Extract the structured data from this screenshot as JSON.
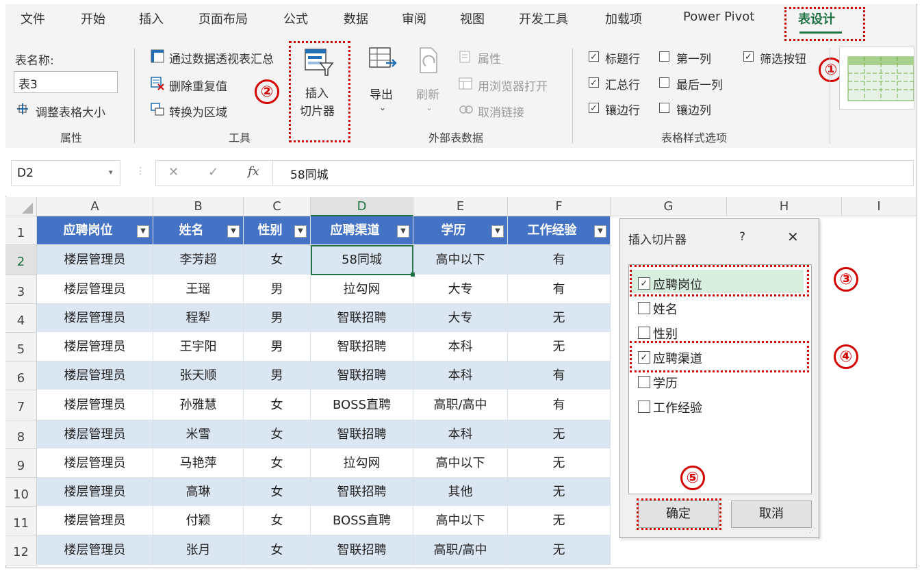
{
  "tabs": [
    "文件",
    "开始",
    "插入",
    "页面布局",
    "公式",
    "数据",
    "审阅",
    "视图",
    "开发工具",
    "加载项",
    "Power Pivot",
    "表设计"
  ],
  "props": {
    "name_label": "表名称:",
    "table_name": "表3",
    "resize": "调整表格大小",
    "group": "属性"
  },
  "tools": {
    "pivot": "通过数据透视表汇总",
    "dedupe": "删除重复值",
    "convert": "转换为区域",
    "group": "工具"
  },
  "slicer": {
    "line1": "插入",
    "line2": "切片器"
  },
  "external": {
    "export": "导出",
    "refresh": "刷新",
    "properties": "属性",
    "open_browser": "用浏览器打开",
    "unlink": "取消链接",
    "group": "外部表数据"
  },
  "style_opts": {
    "header_row": "标题行",
    "first_col": "第一列",
    "filter_btn": "筛选按钮",
    "total_row": "汇总行",
    "last_col": "最后一列",
    "banded_rows": "镶边行",
    "banded_cols": "镶边列",
    "group": "表格样式选项"
  },
  "formula": {
    "ref": "D2",
    "fx": "fx",
    "value": "58同城"
  },
  "columns": [
    "A",
    "B",
    "C",
    "D",
    "E",
    "F",
    "G",
    "H",
    "I"
  ],
  "rows": [
    "1",
    "2",
    "3",
    "4",
    "5",
    "6",
    "7",
    "8",
    "9",
    "10",
    "11",
    "12"
  ],
  "table": {
    "headers": [
      "应聘岗位",
      "姓名",
      "性别",
      "应聘渠道",
      "学历",
      "工作经验"
    ],
    "data": [
      [
        "楼层管理员",
        "李芳超",
        "女",
        "58同城",
        "高中以下",
        "有"
      ],
      [
        "楼层管理员",
        "王瑶",
        "男",
        "拉勾网",
        "大专",
        "有"
      ],
      [
        "楼层管理员",
        "程犁",
        "男",
        "智联招聘",
        "大专",
        "无"
      ],
      [
        "楼层管理员",
        "王宇阳",
        "男",
        "智联招聘",
        "本科",
        "无"
      ],
      [
        "楼层管理员",
        "张天顺",
        "男",
        "智联招聘",
        "本科",
        "有"
      ],
      [
        "楼层管理员",
        "孙雅慧",
        "女",
        "BOSS直聘",
        "高职/高中",
        "有"
      ],
      [
        "楼层管理员",
        "米雪",
        "女",
        "智联招聘",
        "本科",
        "无"
      ],
      [
        "楼层管理员",
        "马艳萍",
        "女",
        "拉勾网",
        "高中以下",
        "无"
      ],
      [
        "楼层管理员",
        "高琳",
        "女",
        "智联招聘",
        "其他",
        "无"
      ],
      [
        "楼层管理员",
        "付颖",
        "女",
        "BOSS直聘",
        "高中以下",
        "无"
      ],
      [
        "楼层管理员",
        "张月",
        "女",
        "智联招聘",
        "高职/高中",
        "无"
      ]
    ]
  },
  "dialog": {
    "title": "插入切片器",
    "help": "?",
    "close": "✕",
    "items": [
      {
        "label": "应聘岗位",
        "checked": true
      },
      {
        "label": "姓名",
        "checked": false
      },
      {
        "label": "性别",
        "checked": false
      },
      {
        "label": "应聘渠道",
        "checked": true
      },
      {
        "label": "学历",
        "checked": false
      },
      {
        "label": "工作经验",
        "checked": false
      }
    ],
    "ok": "确定",
    "cancel": "取消"
  },
  "markers": [
    "①",
    "②",
    "③",
    "④",
    "⑤"
  ],
  "colors": {
    "accent": "#217346",
    "header_fill": "#4472c4",
    "band_fill": "#dbe6f3",
    "marker": "#d40000"
  }
}
